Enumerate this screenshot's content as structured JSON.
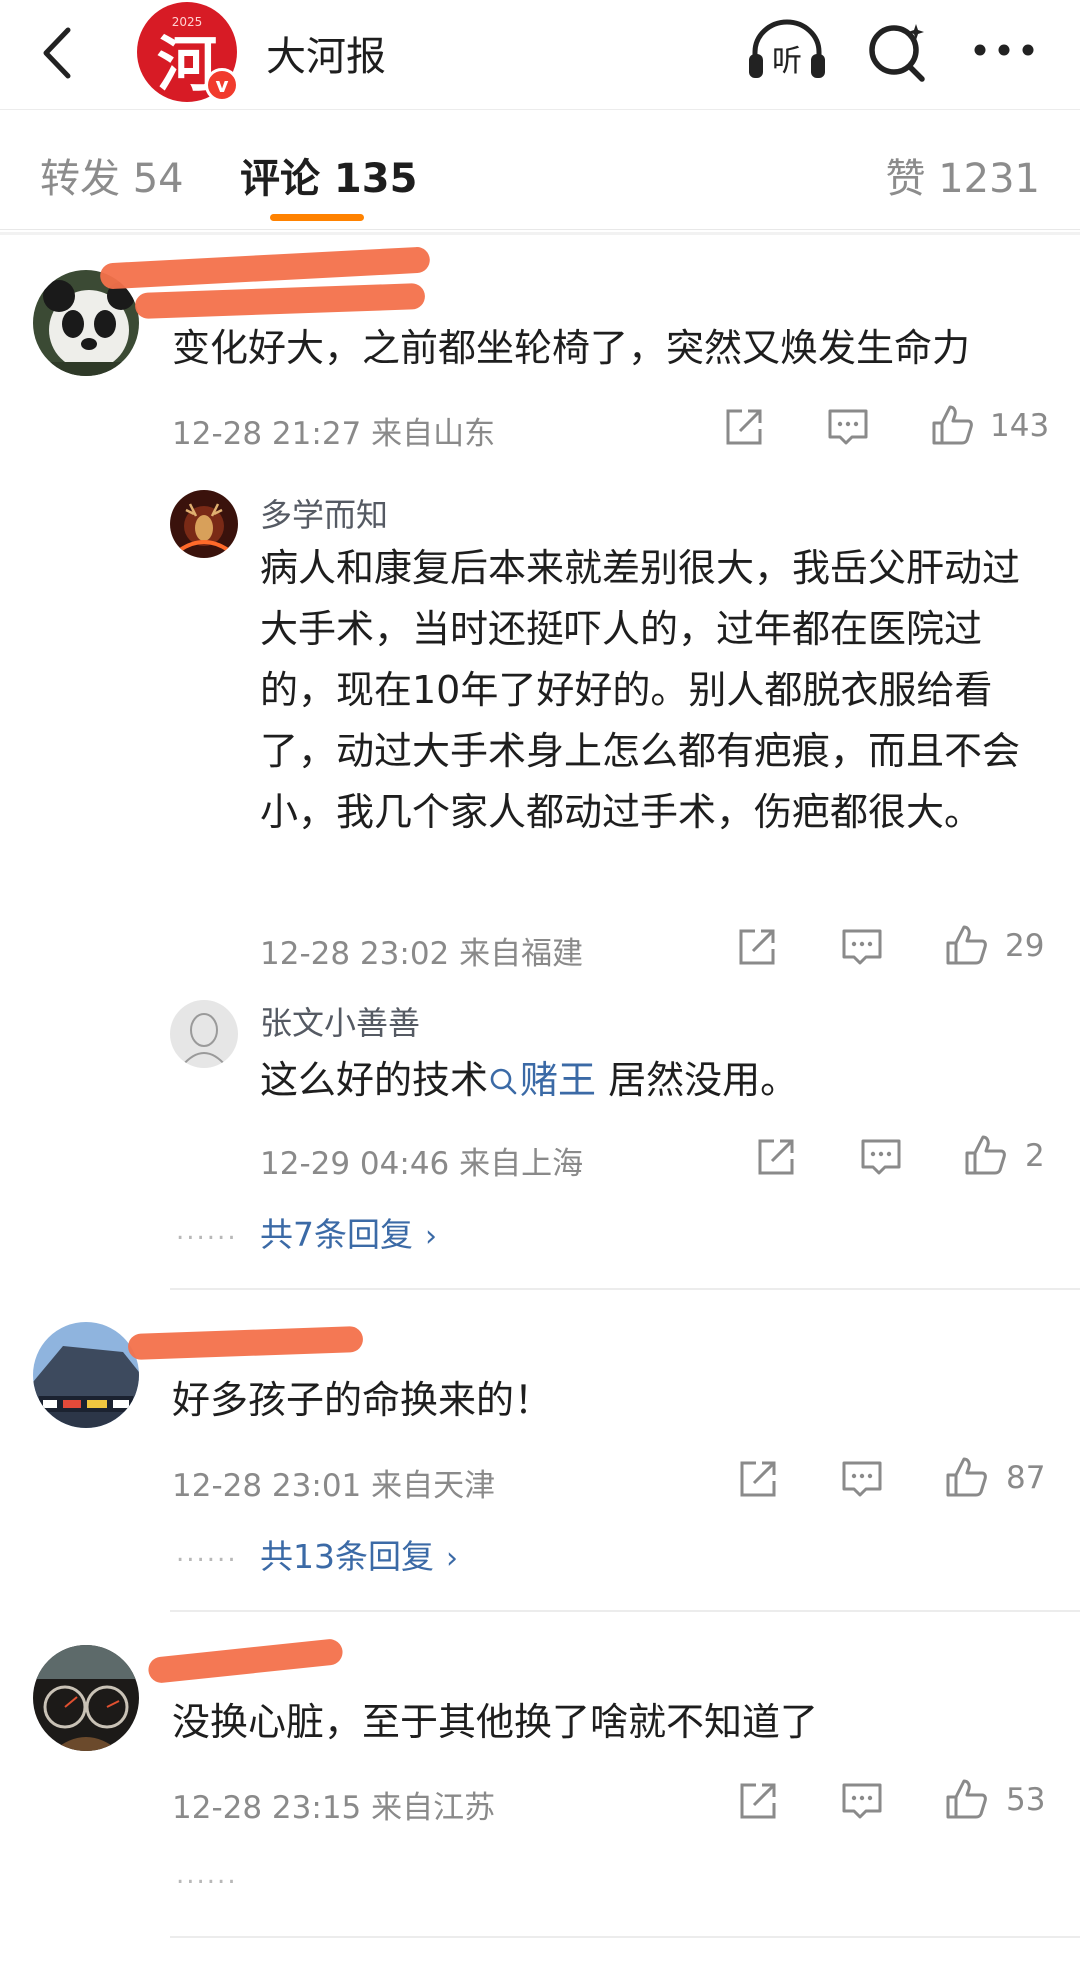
{
  "header": {
    "account_name": "大河报",
    "logo_year": "2025",
    "logo_glyph": "河",
    "verified_badge": "v",
    "listen_label": "听",
    "icons": [
      "back-arrow-icon",
      "listen-headphones-icon",
      "search-icon",
      "more-dots-icon"
    ]
  },
  "tabs": {
    "forward": "转发 54",
    "comments": "评论 135",
    "likes": "赞 1231",
    "accent_color": "#ff8200"
  },
  "comments": [
    {
      "text": "变化好大，之前都坐轮椅了，突然又焕发生命力",
      "meta": "12-28 21:27  来自山东",
      "likes": "143",
      "replies": [
        {
          "nickname": "多学而知",
          "text": "病人和康复后本来就差别很大，我岳父肝动过大手术，当时还挺吓人的，过年都在医院过的，现在10年了好好的。别人都脱衣服给看了，动过大手术身上怎么都有疤痕，而且不会小，我几个家人都动过手术，伤疤都很大。",
          "meta": "12-28 23:02  来自福建",
          "likes": "29"
        },
        {
          "nickname": "张文小善善",
          "text_before": "这么好的技术",
          "hashtag": "赌王",
          "text_after": " 居然没用。",
          "meta": "12-29 04:46  来自上海",
          "likes": "2"
        }
      ],
      "more_replies": "共7条回复",
      "more_dots": "......"
    },
    {
      "text": "好多孩子的命换来的！",
      "meta": "12-28 23:01  来自天津",
      "likes": "87",
      "more_replies": "共13条回复",
      "more_dots": "......"
    },
    {
      "text": "没换心脏，至于其他换了啥就不知道了",
      "meta": "12-28 23:15  来自江苏",
      "likes": "53",
      "more_dots": "......"
    }
  ],
  "colors": {
    "link_blue": "#3b6aa6",
    "meta_gray": "#8a8a8a",
    "redaction": "#f3714b",
    "brand_red": "#d71b25"
  }
}
